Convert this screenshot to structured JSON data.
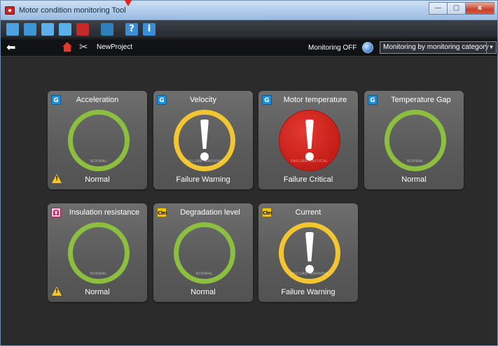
{
  "window": {
    "title": "Motor condition monitoring Tool",
    "minimize_glyph": "—",
    "maximize_glyph": "▢",
    "close_glyph": "x"
  },
  "toolbar": {
    "icons": [
      "new-project-icon",
      "open-project-icon",
      "save-icon",
      "save-as-icon",
      "delete-icon",
      "connection-icon",
      "help-icon",
      "info-icon"
    ],
    "help_glyph": "?",
    "info_glyph": "i"
  },
  "navbar": {
    "back_glyph": "⬅",
    "tools_glyph": "✂",
    "project_name": "NewProject",
    "monitoring_status": "Monitoring OFF",
    "view_select": "Monitoring by monitoring category",
    "dropdown_glyph": "▼"
  },
  "cards": [
    {
      "badge": "G",
      "name": "Acceleration",
      "status": "Normal",
      "ring_text": "NORMAL"
    },
    {
      "badge": "G",
      "name": "Velocity",
      "status": "Failure Warning",
      "ring_text": "FAILURE WARNING"
    },
    {
      "badge": "G",
      "name": "Motor temperature",
      "status": "Failure Critical",
      "ring_text": "FAILURE CRITICAL"
    },
    {
      "badge": "G",
      "name": "Temperature Gap",
      "status": "Normal",
      "ring_text": "NORMAL"
    },
    {
      "badge": "Ω",
      "name": "Insulation resistance",
      "status": "Normal",
      "ring_text": "NORMAL"
    },
    {
      "badge": "Clm",
      "name": "Degradation level",
      "status": "Normal",
      "ring_text": "NORMAL"
    },
    {
      "badge": "Clm",
      "name": "Current",
      "status": "Failure Warning",
      "ring_text": "FAILURE WARNING"
    }
  ],
  "colors": {
    "normal": "#8cbf3f",
    "warning": "#f2c532",
    "critical": "#c41d17"
  }
}
